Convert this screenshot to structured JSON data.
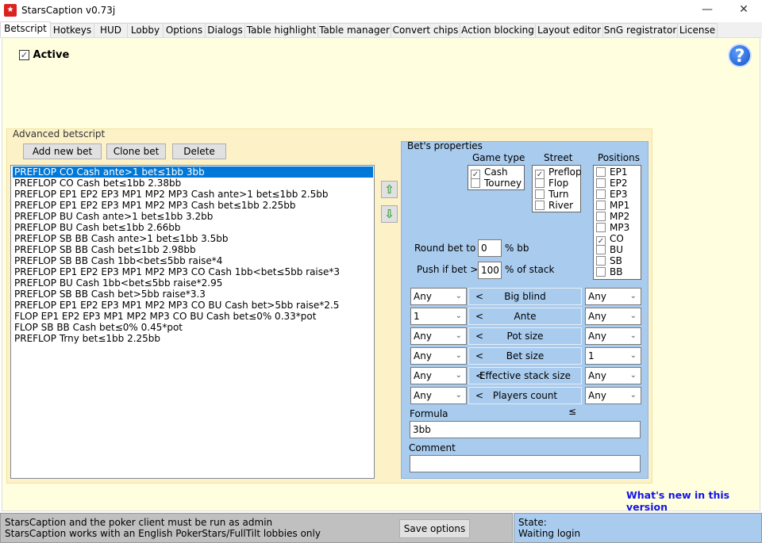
{
  "window": {
    "title": "StarsCaption v0.73j",
    "icon": "stars-caption-logo",
    "controls": {
      "minimize": "—",
      "maximize": "☐",
      "close": "✕"
    }
  },
  "tabs": [
    "Betscript",
    "Hotkeys",
    "HUD",
    "Lobby",
    "Options",
    "Dialogs",
    "Table highlight",
    "Table manager",
    "Convert chips",
    "Action blocking",
    "Layout editor",
    "SnG registrator",
    "License"
  ],
  "active_tab": "Betscript",
  "active_checkbox": {
    "label": "Active",
    "checked": true
  },
  "help_icon": "?",
  "advanced": {
    "title": "Advanced betscript",
    "add_label": "Add new bet",
    "clone_label": "Clone bet",
    "delete_label": "Delete",
    "bets": [
      "PREFLOP CO Cash ante>1 bet≤1bb 3bb",
      "PREFLOP CO Cash bet≤1bb 2.38bb",
      "PREFLOP EP1 EP2 EP3 MP1 MP2 MP3 Cash ante>1 bet≤1bb 2.5bb",
      "PREFLOP EP1 EP2 EP3 MP1 MP2 MP3 Cash bet≤1bb 2.25bb",
      "PREFLOP BU Cash ante>1 bet≤1bb 3.2bb",
      "PREFLOP BU Cash bet≤1bb 2.66bb",
      "PREFLOP SB BB Cash ante>1 bet≤1bb 3.5bb",
      "PREFLOP SB BB Cash bet≤1bb 2.98bb",
      "PREFLOP SB BB Cash 1bb<bet≤5bb raise*4",
      "PREFLOP EP1 EP2 EP3 MP1 MP2 MP3 CO Cash 1bb<bet≤5bb raise*3",
      "PREFLOP BU Cash 1bb<bet≤5bb raise*2.95",
      "PREFLOP SB BB Cash bet>5bb raise*3.3",
      "PREFLOP EP1 EP2 EP3 MP1 MP2 MP3 CO BU Cash bet>5bb raise*2.5",
      "FLOP EP1 EP2 EP3 MP1 MP2 MP3 CO BU Cash bet≤0% 0.33*pot",
      "FLOP SB BB Cash bet≤0% 0.45*pot",
      "PREFLOP Trny bet≤1bb 2.25bb"
    ],
    "selected_index": 0,
    "move_up": "⇧",
    "move_down": "⇩"
  },
  "props": {
    "title": "Bet's properties",
    "game_type": {
      "label": "Game type",
      "items": [
        {
          "label": "Cash",
          "checked": true
        },
        {
          "label": "Tourney",
          "checked": false
        }
      ]
    },
    "street": {
      "label": "Street",
      "items": [
        {
          "label": "Preflop",
          "checked": true
        },
        {
          "label": "Flop",
          "checked": false
        },
        {
          "label": "Turn",
          "checked": false
        },
        {
          "label": "River",
          "checked": false
        }
      ]
    },
    "positions": {
      "label": "Positions",
      "items": [
        {
          "label": "EP1",
          "checked": false
        },
        {
          "label": "EP2",
          "checked": false
        },
        {
          "label": "EP3",
          "checked": false
        },
        {
          "label": "MP1",
          "checked": false
        },
        {
          "label": "MP2",
          "checked": false
        },
        {
          "label": "MP3",
          "checked": false
        },
        {
          "label": "CO",
          "checked": true
        },
        {
          "label": "BU",
          "checked": false
        },
        {
          "label": "SB",
          "checked": false
        },
        {
          "label": "BB",
          "checked": false
        }
      ]
    },
    "round_label": "Round bet to",
    "round_value": "0",
    "round_unit": "% bb",
    "push_label": "Push if bet >",
    "push_value": "100",
    "push_unit": "% of stack",
    "ranges": [
      {
        "min": "Any",
        "name": "Big blind",
        "max": "Any"
      },
      {
        "min": "1",
        "name": "Ante",
        "max": "Any"
      },
      {
        "min": "Any",
        "name": "Pot size",
        "max": "Any"
      },
      {
        "min": "Any",
        "name": "Bet size",
        "max": "1"
      },
      {
        "min": "Any",
        "name": "Effective stack size",
        "max": "Any"
      },
      {
        "min": "Any",
        "name": "Players count",
        "max": "Any"
      }
    ],
    "lt": "<",
    "le": "≤",
    "formula_label": "Formula",
    "formula_value": "3bb",
    "comment_label": "Comment",
    "comment_value": ""
  },
  "whats_new": "What's new in this version",
  "status": {
    "line1": "StarsCaption and the poker client must be run as admin",
    "line2": "StarsCaption works with an English PokerStars/FullTilt lobbies only",
    "save_label": "Save options",
    "state_label": "State:",
    "state_value": "Waiting login"
  }
}
